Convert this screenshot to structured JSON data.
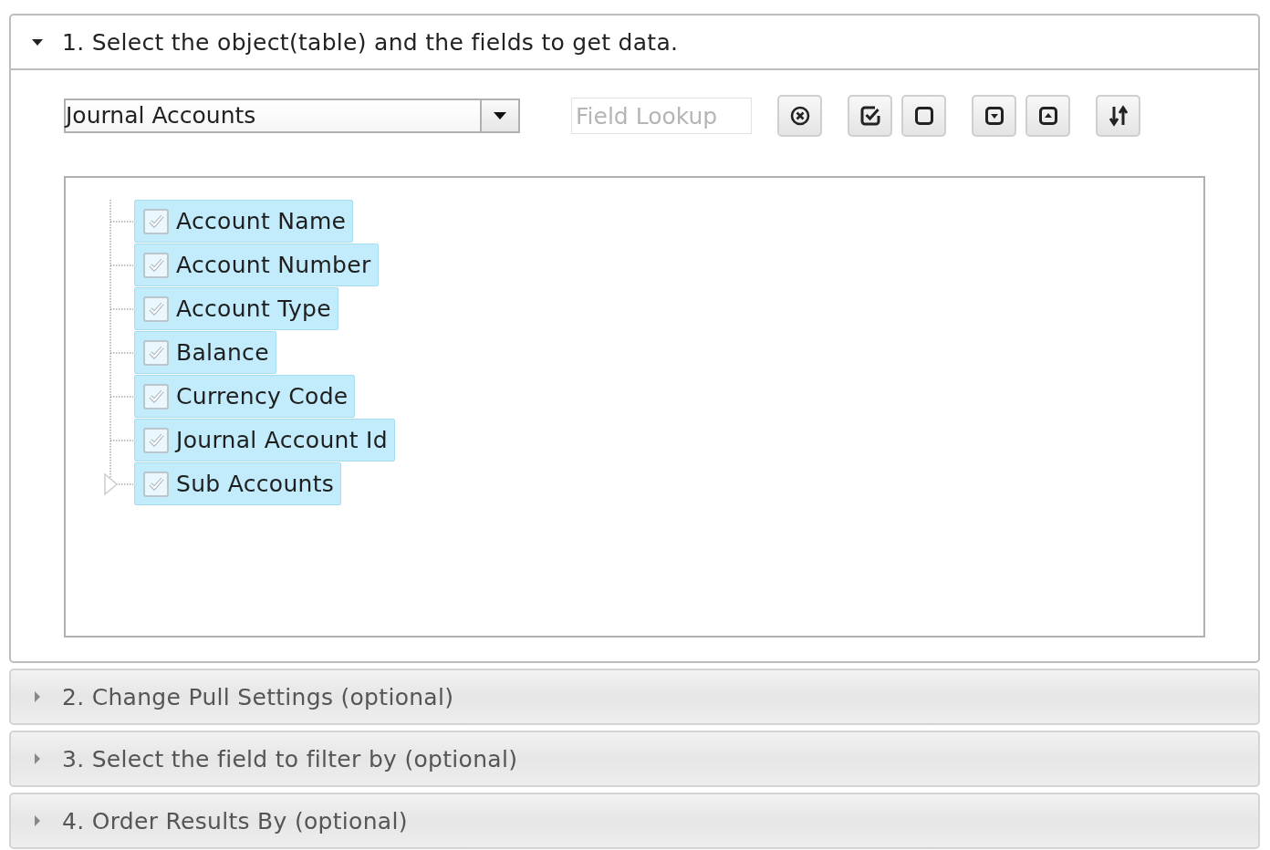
{
  "sections": [
    {
      "title": "1. Select the object(table) and the fields to get data.",
      "expanded": true
    },
    {
      "title": "2. Change Pull Settings (optional)",
      "expanded": false
    },
    {
      "title": "3. Select the field to filter by (optional)",
      "expanded": false
    },
    {
      "title": "4. Order Results By (optional)",
      "expanded": false
    }
  ],
  "object_select": {
    "value": "Journal Accounts"
  },
  "field_lookup": {
    "placeholder": "Field Lookup"
  },
  "fields": [
    {
      "label": "Account Name",
      "kind": "leaf",
      "checked": true,
      "selected": true
    },
    {
      "label": "Account Number",
      "kind": "leaf",
      "checked": true,
      "selected": true
    },
    {
      "label": "Account Type",
      "kind": "leaf",
      "checked": true,
      "selected": true
    },
    {
      "label": "Balance",
      "kind": "leaf",
      "checked": true,
      "selected": true
    },
    {
      "label": "Currency Code",
      "kind": "leaf",
      "checked": true,
      "selected": true
    },
    {
      "label": "Journal Account Id",
      "kind": "leaf",
      "checked": true,
      "selected": true
    },
    {
      "label": "Sub Accounts",
      "kind": "branch",
      "checked": true,
      "selected": true
    }
  ]
}
